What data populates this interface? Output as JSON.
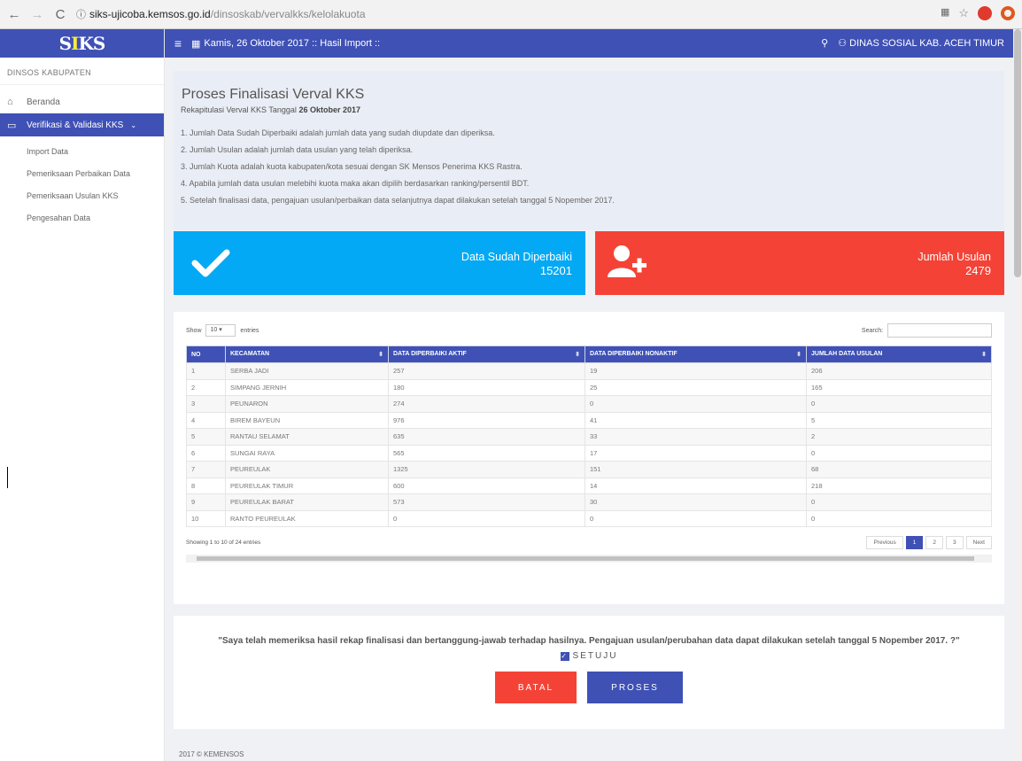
{
  "browser": {
    "url_host": "siks-ujicoba.kemsos.go.id",
    "url_path": "/dinsoskab/vervalkks/kelolakuota"
  },
  "sidebar": {
    "header": "DINSOS KABUPATEN",
    "items": [
      {
        "label": "Beranda"
      },
      {
        "label": "Verifikasi & Validasi KKS"
      }
    ],
    "subitems": [
      {
        "label": "Import Data"
      },
      {
        "label": "Pemeriksaan Perbaikan Data"
      },
      {
        "label": "Pemeriksaan Usulan KKS"
      },
      {
        "label": "Pengesahan Data"
      }
    ]
  },
  "topbar": {
    "date_text": "Kamis, 26 Oktober 2017 :: Hasil Import ::",
    "user_text": "DINAS SOSIAL KAB. ACEH TIMUR"
  },
  "info": {
    "title": "Proses Finalisasi Verval KKS",
    "subtitle_prefix": "Rekapitulasi Verval KKS Tanggal",
    "subtitle_date": "26 Oktober 2017",
    "items": [
      "1. Jumlah Data Sudah Diperbaiki adalah jumlah data yang sudah diupdate dan diperiksa.",
      "2. Jumlah Usulan adalah jumlah data usulan yang telah diperiksa.",
      "3. Jumlah Kuota adalah kuota kabupaten/kota sesuai dengan SK Mensos Penerima KKS Rastra.",
      "4. Apabila jumlah data usulan melebihi kuota maka akan dipilih berdasarkan ranking/persentil BDT.",
      "5. Setelah finalisasi data, pengajuan usulan/perbaikan data selanjutnya dapat dilakukan setelah tanggal 5 Nopember 2017."
    ]
  },
  "stats": {
    "fixed_label": "Data Sudah Diperbaiki",
    "fixed_value": "15201",
    "proposal_label": "Jumlah Usulan",
    "proposal_value": "2479"
  },
  "table": {
    "show_label": "Show",
    "length_value": "10",
    "entries_label": "entries",
    "search_label": "Search:",
    "headers": [
      "NO",
      "KECAMATAN",
      "DATA DIPERBAIKI AKTIF",
      "DATA DIPERBAIKI NONAKTIF",
      "JUMLAH DATA USULAN"
    ],
    "rows": [
      [
        "1",
        "SERBA JADI",
        "257",
        "19",
        "206"
      ],
      [
        "2",
        "SIMPANG JERNIH",
        "180",
        "25",
        "165"
      ],
      [
        "3",
        "PEUNARON",
        "274",
        "0",
        "0"
      ],
      [
        "4",
        "BIREM BAYEUN",
        "976",
        "41",
        "5"
      ],
      [
        "5",
        "RANTAU SELAMAT",
        "635",
        "33",
        "2"
      ],
      [
        "6",
        "SUNGAI RAYA",
        "565",
        "17",
        "0"
      ],
      [
        "7",
        "PEUREULAK",
        "1325",
        "151",
        "68"
      ],
      [
        "8",
        "PEUREULAK TIMUR",
        "600",
        "14",
        "218"
      ],
      [
        "9",
        "PEUREULAK BARAT",
        "573",
        "30",
        "0"
      ],
      [
        "10",
        "RANTO PEUREULAK",
        "0",
        "0",
        "0"
      ]
    ],
    "info_text": "Showing 1 to 10 of 24 entries",
    "pager": {
      "previous": "Previous",
      "pages": [
        "1",
        "2",
        "3"
      ],
      "next": "Next"
    }
  },
  "confirm": {
    "text": "\"Saya telah memeriksa hasil rekap finalisasi dan bertanggung-jawab terhadap hasilnya. Pengajuan usulan/perubahan data dapat dilakukan setelah tanggal 5 Nopember 2017. ?\"",
    "agree_label": "SETUJU",
    "cancel_label": "BATAL",
    "process_label": "PROSES"
  },
  "footer": "2017 © KEMENSOS"
}
